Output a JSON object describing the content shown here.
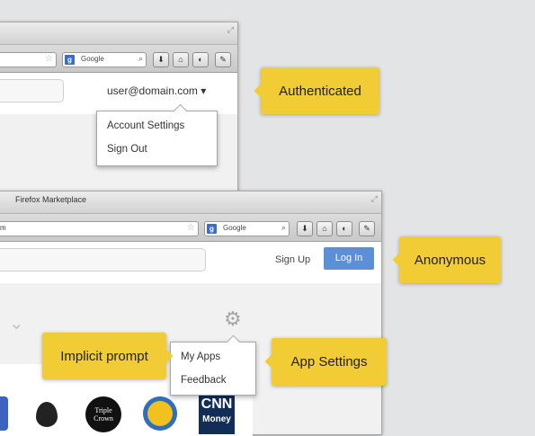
{
  "auth_window": {
    "search_engine": "Google",
    "user_menu_label": "user@domain.com",
    "caret": "▾",
    "menu_items": [
      "Account Settings",
      "Sign Out"
    ]
  },
  "anon_window": {
    "title": "Firefox Marketplace",
    "url_text": "m",
    "search_engine": "Google",
    "signup_label": "Sign Up",
    "login_label": "Log In",
    "menu_items": [
      "My Apps",
      "Feedback"
    ],
    "apps": [
      {
        "name": "Triple Crown",
        "text": "Triple Crown"
      },
      {
        "name": "CNN Money",
        "text_top": "CNN",
        "text_bottom": "Money"
      }
    ]
  },
  "callouts": {
    "authenticated": "Authenticated",
    "anonymous": "Anonymous",
    "implicit_prompt": "Implicit prompt",
    "app_settings": "App Settings"
  },
  "colors": {
    "callout": "#f2cc34",
    "login_button": "#5b8fd6",
    "search_icon_bg": "#3a6ec9"
  }
}
